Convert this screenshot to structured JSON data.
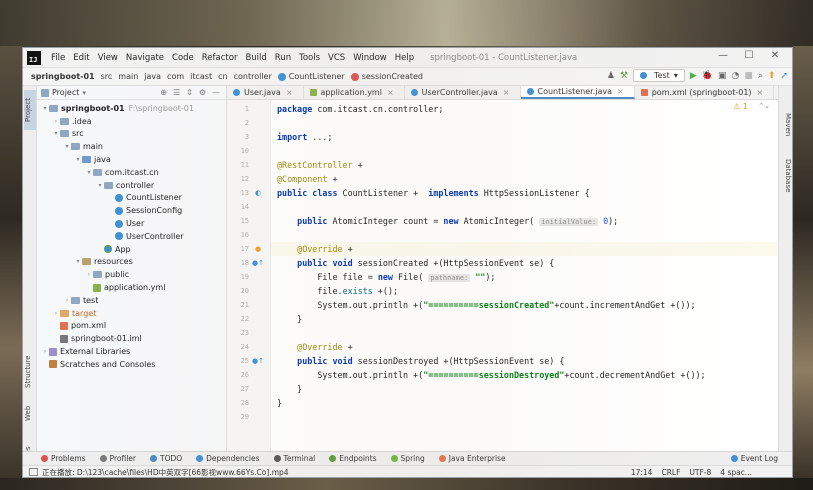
{
  "window": {
    "app_logo": "IJ",
    "title": "springboot-01 - CountListener.java",
    "controls": [
      "—",
      "☐",
      "✕"
    ]
  },
  "menu": [
    "File",
    "Edit",
    "View",
    "Navigate",
    "Code",
    "Refactor",
    "Build",
    "Run",
    "Tools",
    "VCS",
    "Window",
    "Help"
  ],
  "breadcrumb": [
    "springboot-01",
    "src",
    "main",
    "java",
    "com",
    "itcast",
    "cn",
    "controller",
    "CountListener",
    "sessionCreated"
  ],
  "toolbar": {
    "run_config": "Test",
    "run_config_arrow": "▾"
  },
  "left_tabs": [
    "Project",
    "Structure",
    "Web",
    "Favorites"
  ],
  "right_tabs": [
    "Maven",
    "Database"
  ],
  "project_panel": {
    "title": "Project",
    "title_arrow": "▾",
    "tree": [
      {
        "depth": 0,
        "arrow": "▾",
        "icon": "folder-root",
        "label": "springboot-01",
        "extra": "F:\\springboot-01",
        "bold": true
      },
      {
        "depth": 1,
        "arrow": "›",
        "icon": "folder",
        "label": ".idea"
      },
      {
        "depth": 1,
        "arrow": "▾",
        "icon": "folder",
        "label": "src"
      },
      {
        "depth": 2,
        "arrow": "▾",
        "icon": "folder",
        "label": "main"
      },
      {
        "depth": 3,
        "arrow": "▾",
        "icon": "folder-src",
        "label": "java"
      },
      {
        "depth": 4,
        "arrow": "▾",
        "icon": "folder",
        "label": "com.itcast.cn"
      },
      {
        "depth": 5,
        "arrow": "▾",
        "icon": "folder",
        "label": "controller"
      },
      {
        "depth": 6,
        "arrow": "",
        "icon": "cls",
        "label": "CountListener"
      },
      {
        "depth": 6,
        "arrow": "",
        "icon": "cls",
        "label": "SessionConfig"
      },
      {
        "depth": 6,
        "arrow": "",
        "icon": "cls",
        "label": "User"
      },
      {
        "depth": 6,
        "arrow": "",
        "icon": "cls",
        "label": "UserController"
      },
      {
        "depth": 5,
        "arrow": "",
        "icon": "app",
        "label": "App"
      },
      {
        "depth": 3,
        "arrow": "▾",
        "icon": "folder-res",
        "label": "resources"
      },
      {
        "depth": 4,
        "arrow": "›",
        "icon": "folder",
        "label": "public"
      },
      {
        "depth": 4,
        "arrow": "",
        "icon": "yml",
        "label": "application.yml"
      },
      {
        "depth": 2,
        "arrow": "›",
        "icon": "folder",
        "label": "test"
      },
      {
        "depth": 1,
        "arrow": "›",
        "icon": "folder-ex",
        "label": "target",
        "orange": true
      },
      {
        "depth": 1,
        "arrow": "",
        "icon": "xml",
        "label": "pom.xml"
      },
      {
        "depth": 1,
        "arrow": "",
        "icon": "iml",
        "label": "springboot-01.iml"
      },
      {
        "depth": 0,
        "arrow": "›",
        "icon": "lib",
        "label": "External Libraries"
      },
      {
        "depth": 0,
        "arrow": "",
        "icon": "scr",
        "label": "Scratches and Consoles"
      }
    ]
  },
  "editor_tabs": [
    {
      "label": "User.java",
      "icon": "cls"
    },
    {
      "label": "application.yml",
      "icon": "yml"
    },
    {
      "label": "UserController.java",
      "icon": "cls"
    },
    {
      "label": "CountListener.java",
      "icon": "cls",
      "active": true
    },
    {
      "label": "pom.xml (springboot-01)",
      "icon": "xml"
    }
  ],
  "warnings": "⚠ 1",
  "code_lines": [
    {
      "n": "1",
      "html": "<span class=\"kw\">package</span> com.itcast.cn.controller;"
    },
    {
      "n": "2",
      "html": ""
    },
    {
      "n": "3",
      "html": "<span class=\"kw\">import</span> ...;"
    },
    {
      "n": "10",
      "html": ""
    },
    {
      "n": "11",
      "html": "<span class=\"an\">@RestController</span> +"
    },
    {
      "n": "12",
      "html": "<span class=\"an\">@Component</span> +"
    },
    {
      "n": "13",
      "html": "<span class=\"kw\">public class</span> CountListener +  <span class=\"kw\">implements</span> HttpSessionListener {",
      "mark": "impl"
    },
    {
      "n": "14",
      "html": ""
    },
    {
      "n": "15",
      "html": "    <span class=\"kw\">public</span> AtomicInteger count = <span class=\"kw\">new</span> AtomicInteger( <span class=\"hint\">initialValue:</span> <span class=\"num\">0</span>);"
    },
    {
      "n": "16",
      "html": ""
    },
    {
      "n": "17",
      "html": "    <span class=\"an\">@Override</span> +",
      "mark": "bulb",
      "hl": true
    },
    {
      "n": "18",
      "html": "    <span class=\"kw\">public void</span> sessionCreated +(HttpSessionEvent se) {",
      "mark": "over"
    },
    {
      "n": "19",
      "html": "        File file = <span class=\"kw\">new</span> File( <span class=\"hint\">pathname:</span> <span class=\"st\">\"\"</span>);"
    },
    {
      "n": "20",
      "html": "        file.<span class=\"mt\">exists</span> +();"
    },
    {
      "n": "21",
      "html": "        System.out.println +(<span class=\"st\">\"==========sessionCreated\"</span>+count.incrementAndGet +());"
    },
    {
      "n": "22",
      "html": "    }"
    },
    {
      "n": "23",
      "html": ""
    },
    {
      "n": "24",
      "html": "    <span class=\"an\">@Override</span> +"
    },
    {
      "n": "25",
      "html": "    <span class=\"kw\">public void</span> sessionDestroyed +(HttpSessionEvent se) {",
      "mark": "over"
    },
    {
      "n": "26",
      "html": "        System.out.println +(<span class=\"st\">\"==========sessionDestroyed\"</span>+count.decrementAndGet +());"
    },
    {
      "n": "27",
      "html": "    }"
    },
    {
      "n": "28",
      "html": "}"
    },
    {
      "n": "29",
      "html": ""
    }
  ],
  "bottom_tools": [
    {
      "label": "Problems",
      "color": "#d9534f"
    },
    {
      "label": "Profiler",
      "color": "#7a7a7a"
    },
    {
      "label": "TODO",
      "color": "#4a88c7"
    },
    {
      "label": "Dependencies",
      "color": "#3d8fd6"
    },
    {
      "label": "Terminal",
      "color": "#555555"
    },
    {
      "label": "Endpoints",
      "color": "#5a9c3a"
    },
    {
      "label": "Spring",
      "color": "#6db33f"
    },
    {
      "label": "Java Enterprise",
      "color": "#e07050"
    }
  ],
  "event_log": "Event Log",
  "status": {
    "message": "正在播放: D:\\123\\cache\\files\\HD中英双字[66影视www.66Ys.Co].mp4",
    "position": "17:14",
    "line_sep": "CRLF",
    "encoding": "UTF-8",
    "indent": "4 spac..."
  }
}
